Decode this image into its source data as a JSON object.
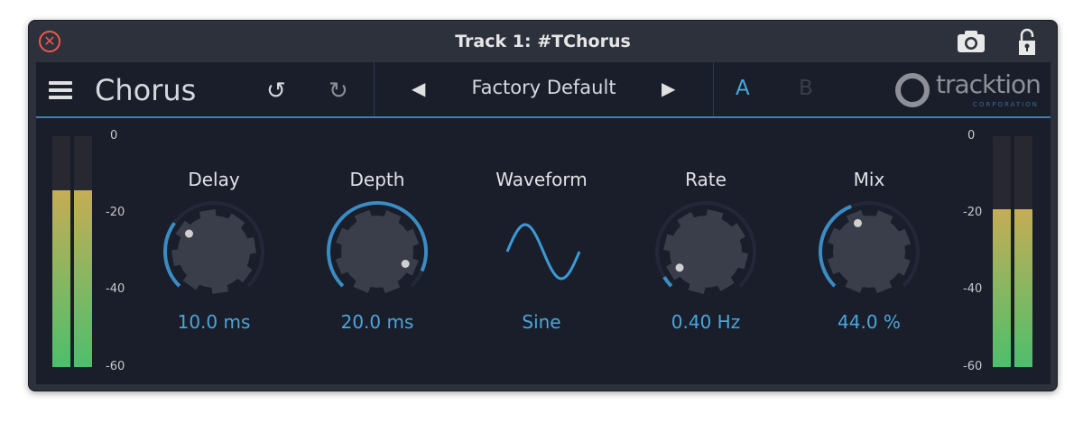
{
  "window": {
    "title": "Track 1: #TChorus"
  },
  "header": {
    "plugin_name": "Chorus",
    "preset": "Factory Default",
    "a_label": "A",
    "b_label": "B",
    "logo": "tracktion",
    "logo_sub": "CORPORATION"
  },
  "meters": {
    "scale": [
      "0",
      "-20",
      "-40",
      "-60"
    ],
    "left_db": [
      -14,
      -14
    ],
    "right_db": [
      -19,
      -19
    ]
  },
  "controls": [
    {
      "label": "Delay",
      "value": "10.0 ms",
      "fraction": 0.3
    },
    {
      "label": "Depth",
      "value": "20.0 ms",
      "fraction": 0.92
    },
    {
      "label": "Waveform",
      "value": "Sine"
    },
    {
      "label": "Rate",
      "value": "0.40 Hz",
      "fraction": 0.05
    },
    {
      "label": "Mix",
      "value": "44.0 %",
      "fraction": 0.42
    }
  ],
  "colors": {
    "accent": "#3b8cc4",
    "value": "#4aa6db",
    "close": "#f0584b"
  }
}
